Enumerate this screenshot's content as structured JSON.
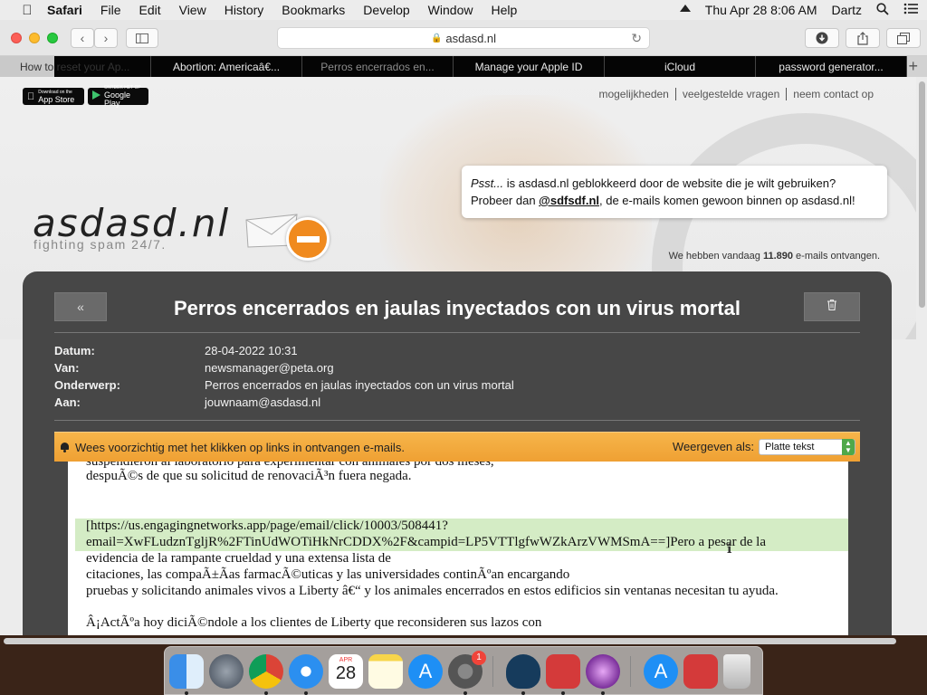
{
  "menubar": {
    "app_name": "Safari",
    "items": [
      "File",
      "Edit",
      "View",
      "History",
      "Bookmarks",
      "Develop",
      "Window",
      "Help"
    ],
    "datetime": "Thu Apr 28  8:06 AM",
    "user": "Dartz",
    "icons": [
      "apple-icon",
      "eject-icon",
      "search-icon",
      "list-icon"
    ]
  },
  "toolbar": {
    "url": "asdasd.nl",
    "icons": [
      "back-icon",
      "forward-icon",
      "sidebar-icon",
      "lock-icon",
      "reload-icon",
      "download-icon",
      "share-icon",
      "tabs-icon"
    ]
  },
  "tabs": [
    {
      "label": "How to reset your Ap..."
    },
    {
      "label": "Abortion: Americaâ€..."
    },
    {
      "label": "Perros encerrados en..."
    },
    {
      "label": "Manage your Apple ID"
    },
    {
      "label": "iCloud"
    },
    {
      "label": "password generator..."
    }
  ],
  "site": {
    "badges": {
      "appstore_small": "Download on the",
      "appstore_big": "App Store",
      "googleplay_small": "ONTDEK HET OP",
      "googleplay_big": "Google Play"
    },
    "nav": [
      "mogelijkheden",
      "veelgestelde vragen",
      "neem contact op"
    ],
    "notice": {
      "psst": "Psst...",
      "text1": " is asdasd.nl geblokkeerd door de website die je wilt gebruiken?",
      "text2_pre": "Probeer dan ",
      "alt_domain": "@sdfsdf.nl",
      "text2_post": ", de e-mails komen gewoon binnen op asdasd.nl!"
    },
    "logo": "asdasd.nl",
    "tagline": "fighting spam 24/7.",
    "counter_pre": "We hebben vandaag ",
    "counter_value": "11.890",
    "counter_post": " e-mails ontvangen."
  },
  "mail": {
    "back_label": "«",
    "title": "Perros encerrados en jaulas inyectados con un virus mortal",
    "meta": [
      {
        "label": "Datum:",
        "value": "28-04-2022 10:31"
      },
      {
        "label": "Van:",
        "value": "newsmanager@peta.org"
      },
      {
        "label": "Onderwerp:",
        "value": "Perros encerrados en jaulas inyectados con un virus mortal"
      },
      {
        "label": "Aan:",
        "value": "jouwnaam@asdasd.nl"
      }
    ],
    "warning": "Wees voorzichtig met het klikken op links in ontvangen e-mails.",
    "view_label": "Weergeven als:",
    "view_value": "Platte tekst",
    "body_lines": [
      "suspendieron al laboratorio para experimentar con animales por dos meses,",
      "despuÃ©s de que su solicitud de renovaciÃ³n fuera negada.",
      "[https://us.engagingnetworks.app/page/email/click/10003/508441?",
      "email=XwFLudznTgljR%2FTinUdWOTiHkNrCDDX%2F&campid=LP5VTTlgfwWZkArzVWMSmA==]Pero a pesar de la",
      "evidencia de la rampante crueldad y una extensa lista de",
      "citaciones, las compaÃ±Ã­as farmacÃ©uticas y las universidades continÃºan encargando",
      "pruebas y solicitando animales vivos a Liberty â€“ y los animales encerrados en estos edificios sin ventanas necesitan tu ayuda.",
      "Â¡ActÃºa hoy diciÃ©ndole a los clientes de Liberty que reconsideren sus lazos con"
    ]
  },
  "dock": {
    "apps": [
      "finder-icon",
      "launchpad-icon",
      "chrome-icon",
      "safari-icon",
      "calendar-icon",
      "notes-icon",
      "appstore-icon",
      "system-preferences-icon",
      "surfshark-icon",
      "mailbox-icon",
      "podcast-icon",
      "appstore2-icon",
      "app-red-icon",
      "trash-icon"
    ],
    "calendar_month": "APR",
    "calendar_day": "28",
    "badge": "1"
  },
  "colors": {
    "mail_panel": "#474747",
    "warning_bar": "#efa033",
    "highlight": "#d4ecc5",
    "stop_sign": "#f08a1e"
  }
}
